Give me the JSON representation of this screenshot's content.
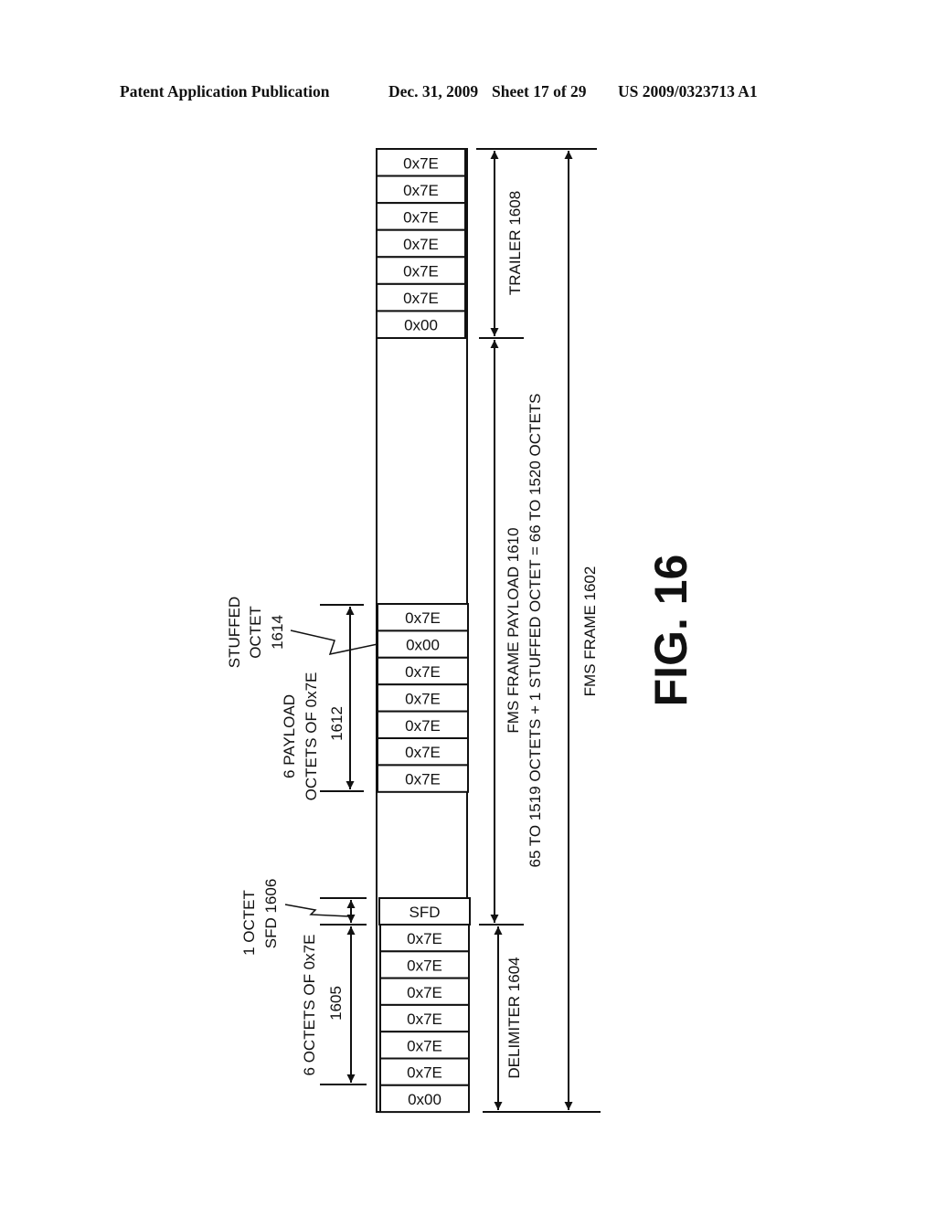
{
  "header": {
    "title": "Patent Application Publication",
    "date": "Dec. 31, 2009",
    "sheet": "Sheet 17 of 29",
    "number": "US 2009/0323713 A1"
  },
  "figure": {
    "label": "FIG. 16",
    "trailer_cells": [
      "0x7E",
      "0x7E",
      "0x7E",
      "0x7E",
      "0x7E",
      "0x7E",
      "0x00"
    ],
    "payload_cells": [
      "0x7E",
      "0x00",
      "0x7E",
      "0x7E",
      "0x7E",
      "0x7E",
      "0x7E"
    ],
    "sfd_cell": "SFD",
    "delimiter_cells": [
      "0x7E",
      "0x7E",
      "0x7E",
      "0x7E",
      "0x7E",
      "0x7E",
      "0x00"
    ],
    "labels": {
      "trailer": "TRAILER 1608",
      "payload_line1": "FMS FRAME PAYLOAD 1610",
      "payload_line2": "65 TO 1519 OCTETS + 1 STUFFED OCTET = 66 TO 1520 OCTETS",
      "frame": "FMS FRAME 1602",
      "delimiter": "DELIMITER 1604",
      "stuffed_line1": "STUFFED",
      "stuffed_line2": "OCTET",
      "stuffed_line3": "1614",
      "payload_octets_line1": "6 PAYLOAD",
      "payload_octets_line2": "OCTETS OF 0x7E",
      "payload_octets_line3": "1612",
      "sfd_line1": "1 OCTET",
      "sfd_line2": "SFD 1606",
      "delim_octets_line1": "6 OCTETS OF 0x7E",
      "delim_octets_line2": "1605"
    }
  }
}
